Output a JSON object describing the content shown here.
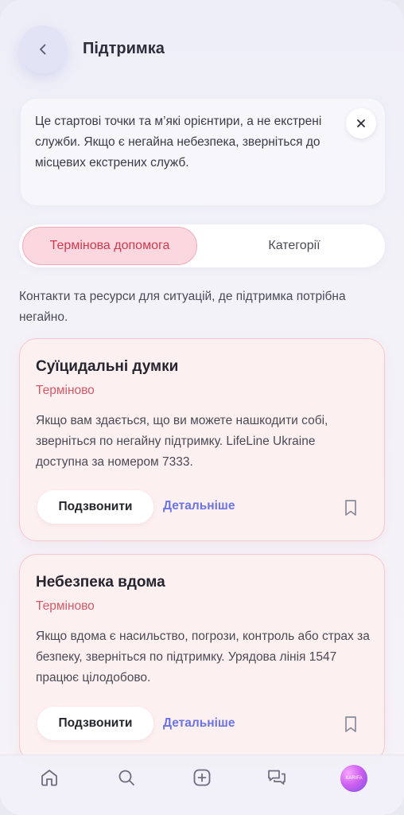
{
  "header": {
    "title": "Підтримка",
    "back_icon": "chevron-left-icon"
  },
  "notice": {
    "text": "Це стартові точки та м’які орієнтири, а не екстрені служби. Якщо є негайна небезпека, зверніться до місцевих екстрених служб.",
    "close_icon": "close-icon"
  },
  "tabs": [
    {
      "label": "Термінова допомога",
      "active": true
    },
    {
      "label": "Категорії",
      "active": false
    }
  ],
  "intro": "Контакти та ресурси для ситуацій, де підтримка потрібна негайно.",
  "cards": [
    {
      "title": "Суїцидальні думки",
      "tag": "Терміново",
      "description": "Якщо вам здається, що ви можете нашкодити собі, зверніться по негайну підтримку. LifeLine Ukraine доступна за номером 7333.",
      "call_label": "Подзвонити",
      "more_label": "Детальніше",
      "bookmark_icon": "bookmark-icon"
    },
    {
      "title": "Небезпека вдома",
      "tag": "Терміново",
      "description": "Якщо вдома є насильство, погрози, контроль або страх за безпеку, зверніться по підтримку. Урядова лінія 1547 працює цілодобово.",
      "call_label": "Подзвонити",
      "more_label": "Детальніше",
      "bookmark_icon": "bookmark-icon"
    }
  ],
  "bottom_nav": {
    "items": [
      "home-icon",
      "search-icon",
      "add-icon",
      "chat-icon",
      "avatar"
    ],
    "avatar_text": "KARIFA"
  },
  "colors": {
    "accent": "#6b74e6",
    "urgent": "#d75767",
    "card_bg": "#fdf0f0",
    "active_tab_bg": "#fbd8df"
  }
}
